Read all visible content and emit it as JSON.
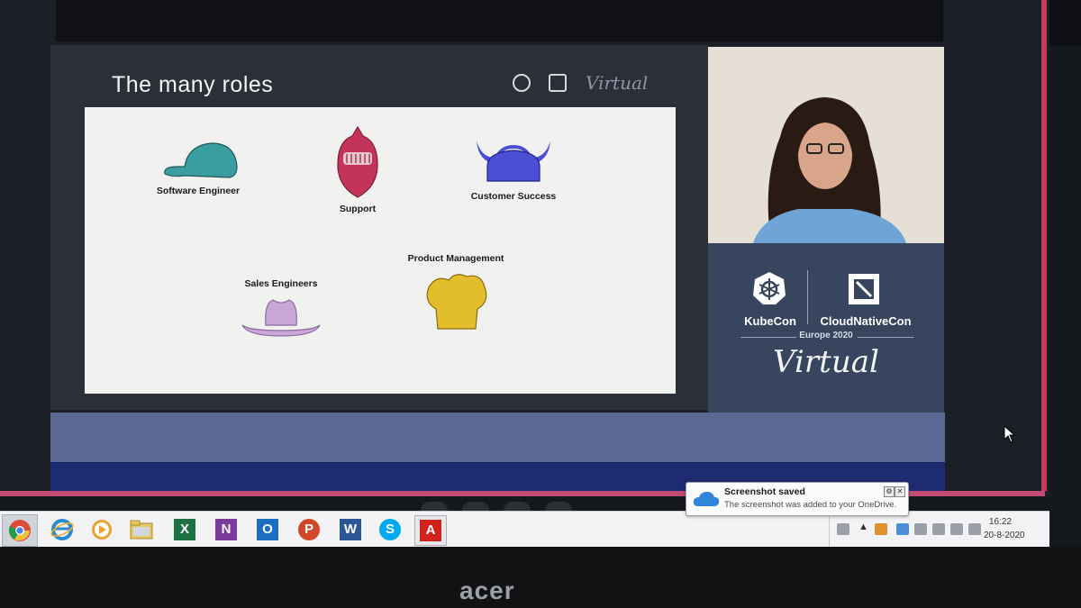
{
  "slide": {
    "title": "The many roles",
    "virtual_logo": "Virtual",
    "roles": [
      {
        "label": "Software Engineer",
        "icon": "cap-icon",
        "color": "#3a9ea0"
      },
      {
        "label": "Support",
        "icon": "knight-helmet-icon",
        "color": "#c4345a"
      },
      {
        "label": "Customer Success",
        "icon": "viking-helmet-icon",
        "color": "#4a4fd6"
      },
      {
        "label": "Product Management",
        "icon": "chef-hat-icon",
        "color": "#e2bd2c"
      },
      {
        "label": "Sales Engineers",
        "icon": "cowboy-hat-icon",
        "color": "#c8a8d8"
      }
    ]
  },
  "event": {
    "kubecon": "KubeCon",
    "cloudnativecon": "CloudNativeCon",
    "edition": "Europe 2020",
    "virtual": "Virtual"
  },
  "notification": {
    "title": "Screenshot saved",
    "body": "The screenshot was added to your OneDrive.",
    "icon": "onedrive-cloud-icon"
  },
  "taskbar": {
    "apps": [
      {
        "name": "chrome-icon",
        "color": "#dd4b39"
      },
      {
        "name": "internet-explorer-icon",
        "color": "#2a8ad4"
      },
      {
        "name": "media-player-icon",
        "color": "#f0a030"
      },
      {
        "name": "file-explorer-icon",
        "color": "#e8c860"
      },
      {
        "name": "excel-icon",
        "color": "#1f7244",
        "letter": "X"
      },
      {
        "name": "onenote-icon",
        "color": "#7a3b9c",
        "letter": "N"
      },
      {
        "name": "outlook-icon",
        "color": "#1b6ec2",
        "letter": "O"
      },
      {
        "name": "powerpoint-icon",
        "color": "#d24726",
        "letter": "P"
      },
      {
        "name": "word-icon",
        "color": "#2b5797",
        "letter": "W"
      },
      {
        "name": "skype-icon",
        "color": "#00a9f0",
        "letter": "S"
      },
      {
        "name": "acrobat-icon",
        "color": "#d2221c",
        "letter": "A"
      }
    ],
    "clock": {
      "time": "16:22",
      "date": "20-8-2020"
    }
  },
  "device": {
    "brand": "acer"
  }
}
